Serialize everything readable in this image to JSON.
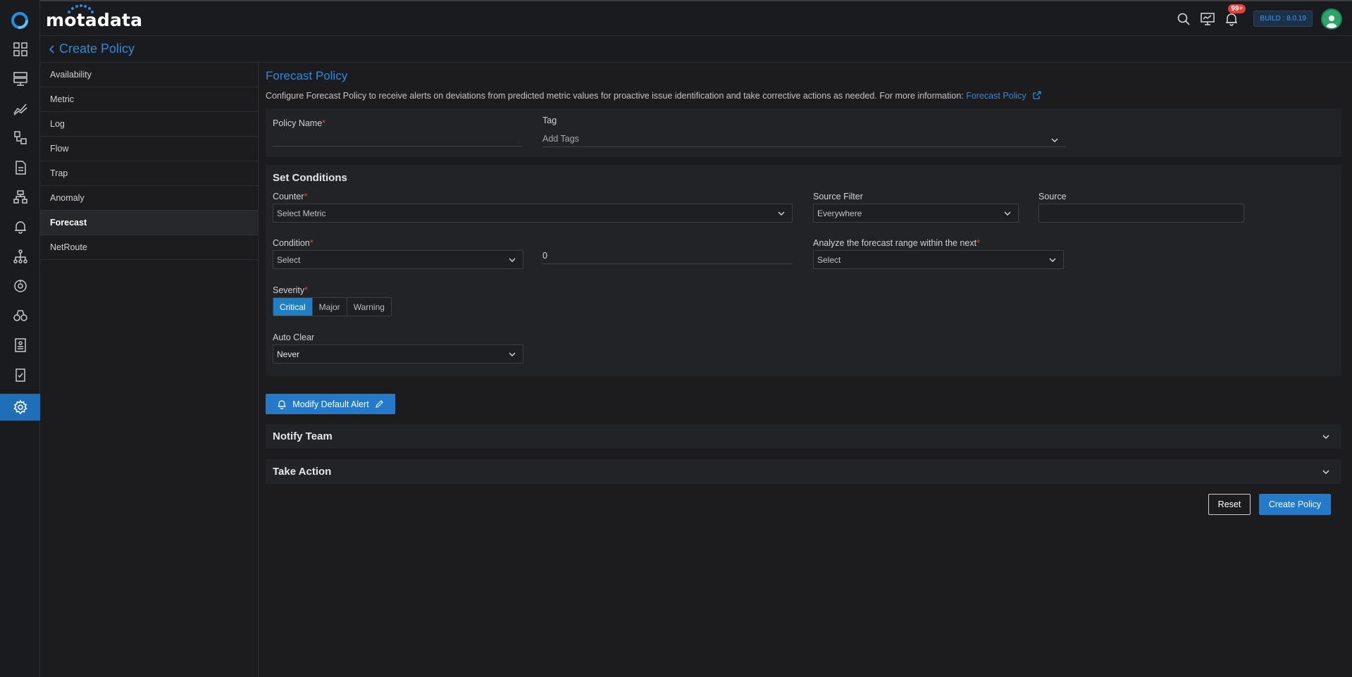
{
  "header": {
    "brand": "motadata",
    "notification_count": "99+",
    "build": "BUILD : 8.0.19"
  },
  "titlebar": {
    "title": "Create Policy"
  },
  "subnav": {
    "items": [
      {
        "label": "Availability"
      },
      {
        "label": "Metric"
      },
      {
        "label": "Log"
      },
      {
        "label": "Flow"
      },
      {
        "label": "Trap"
      },
      {
        "label": "Anomaly"
      },
      {
        "label": "Forecast"
      },
      {
        "label": "NetRoute"
      }
    ],
    "active_index": 6
  },
  "main": {
    "title": "Forecast Policy",
    "description": "Configure Forecast Policy to receive alerts on deviations from predicted metric values for proactive issue identification and take corrective actions as needed. For more information: ",
    "description_link": "Forecast Policy"
  },
  "form": {
    "policy_name_label": "Policy Name",
    "policy_name_value": "",
    "tag_label": "Tag",
    "tag_placeholder": "Add Tags",
    "set_conditions_title": "Set Conditions",
    "counter_label": "Counter",
    "counter_placeholder": "Select Metric",
    "source_filter_label": "Source Filter",
    "source_filter_value": "Everywhere",
    "source_label": "Source",
    "source_value": "",
    "condition_label": "Condition",
    "condition_placeholder": "Select",
    "condition_value": "0",
    "analyze_label": "Analyze the forecast range within the next",
    "analyze_placeholder": "Select",
    "severity_label": "Severity",
    "severity_options": [
      "Critical",
      "Major",
      "Warning"
    ],
    "severity_selected": "Critical",
    "auto_clear_label": "Auto Clear",
    "auto_clear_value": "Never",
    "required_mark": "*"
  },
  "actions": {
    "modify_alert_label": "Modify Default Alert",
    "notify_team_title": "Notify Team",
    "take_action_title": "Take Action",
    "reset_label": "Reset",
    "create_label": "Create Policy"
  },
  "colors": {
    "accent": "#2479c9",
    "link": "#2e8ad8",
    "required": "#e8403a",
    "background": "#1c1c1e"
  },
  "icons": {
    "rail": [
      "dashboard-icon",
      "monitor-icon",
      "metric-explorer-icon",
      "topology-icon",
      "log-icon",
      "flow-icon",
      "alert-icon",
      "network-icon",
      "netroute-icon",
      "observability-icon",
      "report-icon",
      "audit-icon",
      "settings-icon"
    ]
  }
}
